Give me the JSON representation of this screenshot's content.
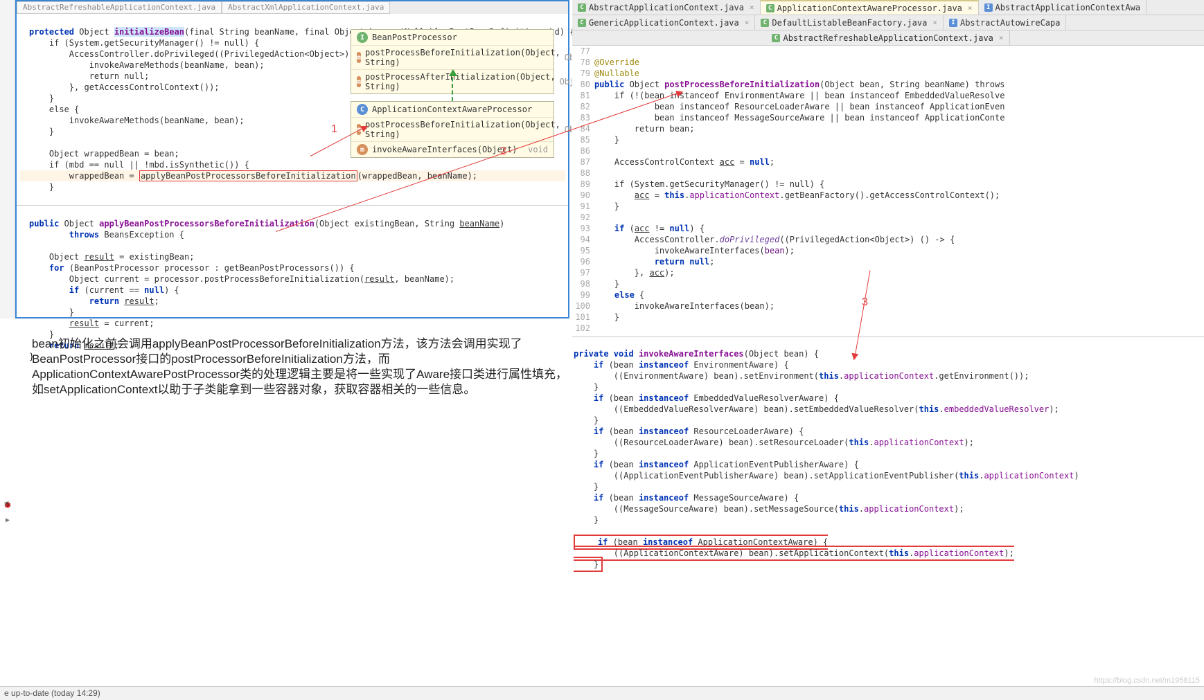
{
  "left_tabs": {
    "t1": "AbstractRefreshableApplicationContext.java",
    "t2": "AbstractXmlApplicationContext.java"
  },
  "right_tabs": {
    "r1": "AbstractApplicationContext.java",
    "r2": "ApplicationContextAwareProcessor.java",
    "r3": "AbstractApplicationContextAwa",
    "r4": "GenericApplicationContext.java",
    "r5": "DefaultListableBeanFactory.java",
    "r6": "AbstractAutowireCapa",
    "r7": "AbstractRefreshableApplicationContext.java"
  },
  "popup_top": {
    "title": "BeanPostProcessor",
    "m1": "postProcessBeforeInitialization(Object, String)",
    "m1r": "Object",
    "m2": "postProcessAfterInitialization(Object, String)",
    "m2r": "Object"
  },
  "popup_bot": {
    "title": "ApplicationContextAwareProcessor",
    "m1": "postProcessBeforeInitialization(Object, String)",
    "m1r": "Object",
    "m2": "invokeAwareInterfaces(Object)",
    "m2r": "void"
  },
  "labels": {
    "n1": "1",
    "n2": "2",
    "n3": "3"
  },
  "left_code": {
    "l1": "protected Object ",
    "l1b": "initializeBean",
    "l1c": "(final String beanName, final Object bean, @Nullable RootBeanDefinition mbd) {",
    "l2": "    if (System.getSecurityManager() != null) {",
    "l3": "        AccessController.doPrivileged((PrivilegedAction<Object>) () -> {",
    "l4": "            invokeAwareMethods(beanName, bean);",
    "l5": "            return null;",
    "l6": "        }, getAccessControlContext());",
    "l7": "    }",
    "l8": "    else {",
    "l9": "        invokeAwareMethods(beanName, bean);",
    "l10": "    }",
    "l11": "",
    "l12": "    Object wrappedBean = bean;",
    "l13": "    if (mbd == null || !mbd.isSynthetic()) {",
    "l14a": "        wrappedBean = ",
    "l14b": "applyBeanPostProcessorsBeforeInitialization",
    "l14c": "(wrappedBean, beanName);",
    "l15": "    }",
    "m1": "public Object applyBeanPostProcessorsBeforeInitialization(Object existingBean, String beanName)",
    "m2": "        throws BeansException {",
    "m3": "",
    "m4": "    Object result = existingBean;",
    "m5": "    for (BeanPostProcessor processor : getBeanPostProcessors()) {",
    "m6": "        Object current = processor.postProcessBeforeInitialization(result, beanName);",
    "m7": "        if (current == null) {",
    "m8": "            return result;",
    "m9": "        }",
    "m10": "        result = current;",
    "m11": "    }",
    "m12": "    return result;",
    "m13": "}"
  },
  "ln": {
    "n77": "77",
    "n78": "78",
    "n79": "79",
    "n80": "80",
    "n81": "81",
    "n82": "82",
    "n83": "83",
    "n84": "84",
    "n85": "85",
    "n86": "86",
    "n87": "87",
    "n88": "88",
    "n89": "89",
    "n90": "90",
    "n91": "91",
    "n92": "92",
    "n93": "93",
    "n94": "94",
    "n95": "95",
    "n96": "96",
    "n97": "97",
    "n98": "98",
    "n99": "99",
    "n100": "100",
    "n101": "101",
    "n102": "102"
  },
  "right_code": {
    "r1": "@Override",
    "r2": "@Nullable",
    "r3a": "public Object ",
    "r3b": "postProcessBeforeInitialization",
    "r3c": "(Object bean, String beanName) throws",
    "r4": "    if (!(bean instanceof EnvironmentAware || bean instanceof EmbeddedValueResolve",
    "r5": "            bean instanceof ResourceLoaderAware || bean instanceof ApplicationEven",
    "r6": "            bean instanceof MessageSourceAware || bean instanceof ApplicationConte",
    "r7": "        return bean;",
    "r8": "    }",
    "r9": "",
    "r10": "    AccessControlContext acc = null;",
    "r11": "",
    "r12": "    if (System.getSecurityManager() != null) {",
    "r13": "        acc = this.applicationContext.getBeanFactory().getAccessControlContext();",
    "r14": "    }",
    "r15": "",
    "r16": "    if (acc != null) {",
    "r17": "        AccessController.doPrivileged((PrivilegedAction<Object>) () -> {",
    "r18": "            invokeAwareInterfaces(bean);",
    "r19": "            return null;",
    "r20": "        }, acc);",
    "r21": "    }",
    "r22": "    else {",
    "r23": "        invokeAwareInterfaces(bean);",
    "r24": "    }"
  },
  "lower_code": {
    "s0": "private void invokeAwareInterfaces(Object bean) {",
    "s1": "    if (bean instanceof EnvironmentAware) {",
    "s2": "        ((EnvironmentAware) bean).setEnvironment(this.applicationContext.getEnvironment());",
    "s3": "    }",
    "s4": "    if (bean instanceof EmbeddedValueResolverAware) {",
    "s5": "        ((EmbeddedValueResolverAware) bean).setEmbeddedValueResolver(this.embeddedValueResolver);",
    "s6": "    }",
    "s7": "    if (bean instanceof ResourceLoaderAware) {",
    "s8": "        ((ResourceLoaderAware) bean).setResourceLoader(this.applicationContext);",
    "s9": "    }",
    "s10": "    if (bean instanceof ApplicationEventPublisherAware) {",
    "s11": "        ((ApplicationEventPublisherAware) bean).setApplicationEventPublisher(this.applicationContext)",
    "s12": "    }",
    "s13": "    if (bean instanceof MessageSourceAware) {",
    "s14": "        ((MessageSourceAware) bean).setMessageSource(this.applicationContext);",
    "s15": "    }",
    "s16": "",
    "s17": "    if (bean instanceof ApplicationContextAware) {",
    "s18": "        ((ApplicationContextAware) bean).setApplicationContext(this.applicationContext);",
    "s19": "    }"
  },
  "paragraph": "bean初始化之前会调用applyBeanPostProcessorBeforeInitialization方法，该方法会调用实现了BeanPostProcessor接口的postProcessorBeforeInitialization方法，而ApplicationContextAwarePostProcessor类的处理逻辑主要是将一些实现了Aware接口类进行属性填充，如setApplicationContext以助于子类能拿到一些容器对象，获取容器相关的一些信息。",
  "status": "e up-to-date (today 14:29)",
  "watermark": "https://blog.csdn.net/m1958115"
}
